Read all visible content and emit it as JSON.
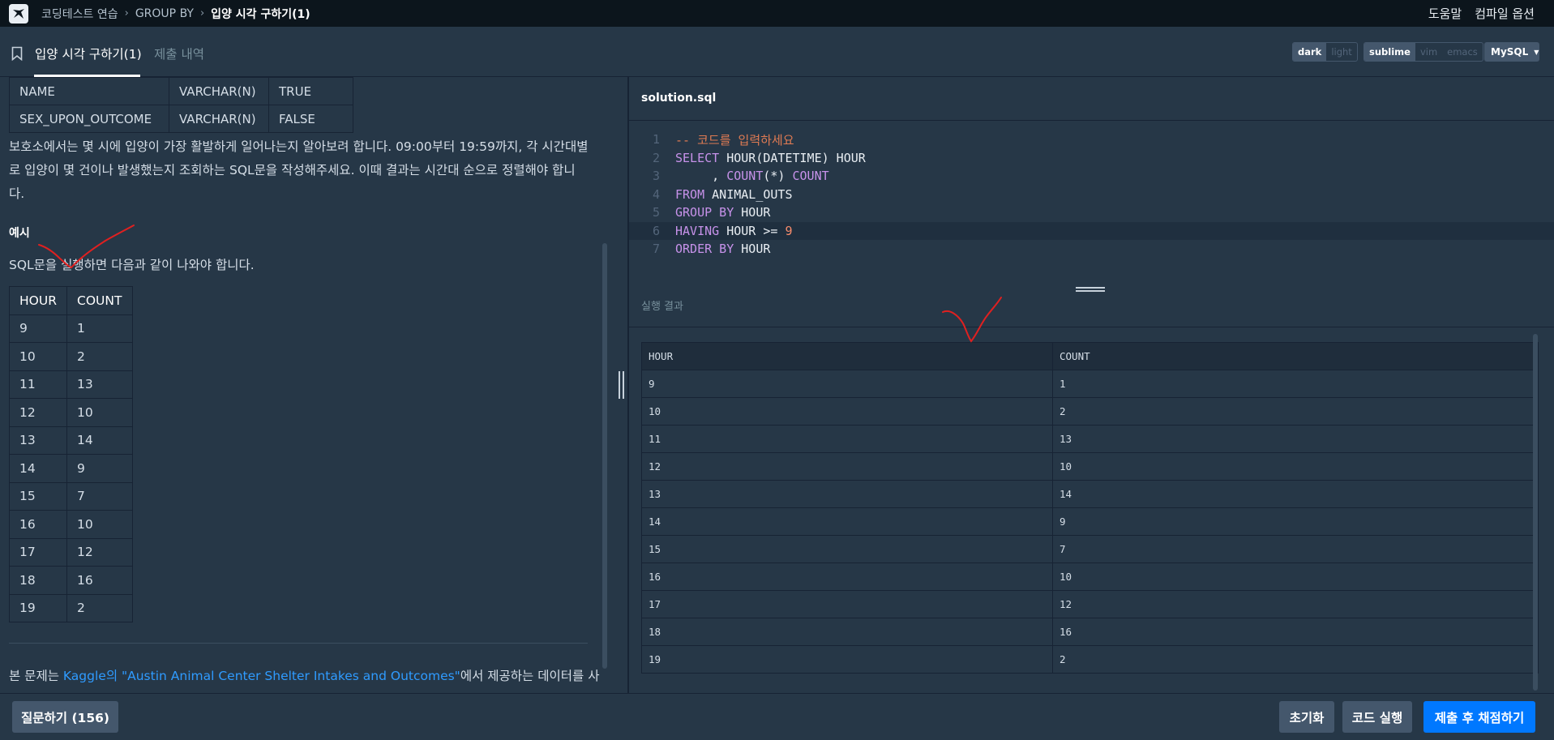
{
  "nav": {
    "breadcrumbs": [
      "코딩테스트 연습",
      "GROUP BY",
      "입양 시각 구하기(1)"
    ],
    "help": "도움말",
    "compile_options": "컴파일 옵션"
  },
  "tabs": {
    "active": "입양 시각 구하기(1)",
    "inactive": "제출 내역"
  },
  "options": {
    "theme": [
      "dark",
      "light"
    ],
    "keymap": [
      "sublime",
      "vim",
      "emacs"
    ],
    "language": "MySQL"
  },
  "schema_rows": [
    [
      "NAME",
      "VARCHAR(N)",
      "TRUE"
    ],
    [
      "SEX_UPON_OUTCOME",
      "VARCHAR(N)",
      "FALSE"
    ]
  ],
  "description": "보호소에서는 몇 시에 입양이 가장 활발하게 일어나는지 알아보려 합니다. 09:00부터 19:59까지, 각 시간대별로 입양이 몇 건이나 발생했는지 조회하는 SQL문을 작성해주세요. 이때 결과는 시간대 순으로 정렬해야 합니다.",
  "example": {
    "title": "예시",
    "text": "SQL문을 실행하면 다음과 같이 나와야 합니다.",
    "headers": [
      "HOUR",
      "COUNT"
    ],
    "rows": [
      [
        "9",
        "1"
      ],
      [
        "10",
        "2"
      ],
      [
        "11",
        "13"
      ],
      [
        "12",
        "10"
      ],
      [
        "13",
        "14"
      ],
      [
        "14",
        "9"
      ],
      [
        "15",
        "7"
      ],
      [
        "16",
        "10"
      ],
      [
        "17",
        "12"
      ],
      [
        "18",
        "16"
      ],
      [
        "19",
        "2"
      ]
    ]
  },
  "source": {
    "before": "본 문제는 ",
    "link": "Kaggle의 \"Austin Animal Center Shelter Intakes and Outcomes\"",
    "after": "에서 제공하는 데이터를 사"
  },
  "editor": {
    "filename": "solution.sql",
    "line_numbers": [
      "1",
      "2",
      "3",
      "4",
      "5",
      "6",
      "7"
    ]
  },
  "result": {
    "title": "실행 결과",
    "headers": [
      "HOUR",
      "COUNT"
    ],
    "rows": [
      [
        "9",
        "1"
      ],
      [
        "10",
        "2"
      ],
      [
        "11",
        "13"
      ],
      [
        "12",
        "10"
      ],
      [
        "13",
        "14"
      ],
      [
        "14",
        "9"
      ],
      [
        "15",
        "7"
      ],
      [
        "16",
        "10"
      ],
      [
        "17",
        "12"
      ],
      [
        "18",
        "16"
      ],
      [
        "19",
        "2"
      ]
    ]
  },
  "buttons": {
    "question": "질문하기 (156)",
    "reset": "초기화",
    "run": "코드 실행",
    "submit": "제출 후 채점하기"
  },
  "colors": {
    "background": "#263747",
    "topbar": "#0c151c",
    "primary_button": "#0078ff",
    "annotation": "#e02020"
  }
}
